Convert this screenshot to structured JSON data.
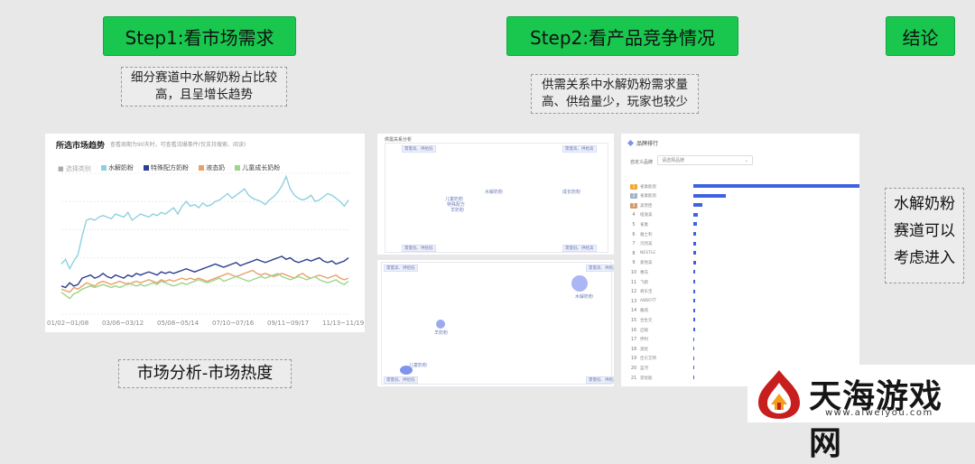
{
  "step1": {
    "title": "Step1:看市场需求",
    "note_line1": "细分赛道中水解奶粉占比较",
    "note_line2": "高，且呈增长趋势"
  },
  "step2": {
    "title": "Step2:看产品竞争情况",
    "note_line1": "供需关系中水解奶粉需求量",
    "note_line2": "高、供给量少，玩家也较少"
  },
  "conclusion": {
    "title": "结论",
    "text_line1": "水解奶粉",
    "text_line2": "赛道可以",
    "text_line3": "考虑进入"
  },
  "bottom_label": "市场分析-市场热度",
  "trend_panel": {
    "title": "所选市场趋势",
    "subtitle": "查看周期为90天时，可查看流爆事件(仅支持搜索、阅读)"
  },
  "rank_panel": {
    "title": "品牌排行",
    "filter_label": "自定义品牌",
    "filter_value": "请选择品牌",
    "items": [
      {
        "rank": "1",
        "name": "雀巢能恩",
        "value": 100
      },
      {
        "rank": "2",
        "name": "雀巢能恩",
        "value": 19
      },
      {
        "rank": "3",
        "name": "美赞臣",
        "value": 5
      },
      {
        "rank": "4",
        "name": "纽滋美",
        "value": 2.6
      },
      {
        "rank": "5",
        "name": "雀巢",
        "value": 2
      },
      {
        "rank": "6",
        "name": "雅士利",
        "value": 1.8
      },
      {
        "rank": "7",
        "name": "贝因美",
        "value": 1.6
      },
      {
        "rank": "8",
        "name": "NESTLE",
        "value": 1.5
      },
      {
        "rank": "9",
        "name": "爱他美",
        "value": 1.4
      },
      {
        "rank": "10",
        "name": "惠氏",
        "value": 1.3
      },
      {
        "rank": "11",
        "name": "飞鹤",
        "value": 1.2
      },
      {
        "rank": "12",
        "name": "君乐宝",
        "value": 1.1
      },
      {
        "rank": "13",
        "name": "ABBOTT",
        "value": 1
      },
      {
        "rank": "14",
        "name": "雅培",
        "value": 0.9
      },
      {
        "rank": "15",
        "name": "合生元",
        "value": 0.8
      },
      {
        "rank": "16",
        "name": "启赋",
        "value": 0.8
      },
      {
        "rank": "17",
        "name": "伊利",
        "value": 0.7
      },
      {
        "rank": "18",
        "name": "澳优",
        "value": 0.7
      },
      {
        "rank": "19",
        "name": "佳贝艾特",
        "value": 0.6
      },
      {
        "rank": "20",
        "name": "蓝河",
        "value": 0.6
      },
      {
        "rank": "21",
        "name": "诺优能",
        "value": 0.5
      }
    ]
  },
  "supply_panel": {
    "title": "供需关系分析",
    "tags": [
      "需量高、供给低",
      "需量高、供给高",
      "需量低、供给低",
      "需量低、供给高"
    ],
    "labels": [
      "儿童奶粉",
      "特殊配方",
      "水解奶粉",
      "成长奶粉",
      "羊奶粉"
    ],
    "tags2": [
      "需量高、供给低",
      "需量高、供给高",
      "需量低、供给低",
      "需量低、供给高"
    ],
    "bubble_labels": [
      "水解奶粉",
      "羊奶粉",
      "儿童奶粉"
    ]
  },
  "logo": {
    "main": "天海游戏网",
    "url": "www.aiweiyou.com"
  },
  "chart_data": {
    "type": "line",
    "legend_prefix": "■ 选择类别",
    "x_ticks": [
      "01/02~01/08",
      "03/06~03/12",
      "05/08~05/14",
      "07/10~07/16",
      "09/11~09/17",
      "11/13~11/19"
    ],
    "series": [
      {
        "name": "水解奶粉",
        "color": "#8fd0e0",
        "values": [
          42,
          45,
          39,
          44,
          48,
          60,
          70,
          71,
          70,
          72,
          73,
          72,
          71,
          74,
          73,
          72,
          75,
          70,
          72,
          74,
          73,
          72,
          74,
          73,
          75,
          74,
          76,
          78,
          74,
          79,
          82,
          79,
          80,
          78,
          81,
          79,
          80,
          82,
          83,
          85,
          87,
          84,
          86,
          88,
          90,
          86,
          84,
          83,
          82,
          80,
          83,
          85,
          88,
          92,
          98,
          90,
          86,
          84,
          83,
          84,
          86,
          82,
          83,
          85,
          87,
          86,
          84,
          82,
          79,
          83
        ]
      },
      {
        "name": "特殊配方奶粉",
        "color": "#2d3f8f",
        "values": [
          28,
          27,
          30,
          28,
          29,
          33,
          34,
          35,
          33,
          34,
          36,
          34,
          33,
          35,
          34,
          33,
          35,
          34,
          36,
          35,
          36,
          37,
          36,
          35,
          37,
          36,
          37,
          36,
          37,
          38,
          39,
          38,
          37,
          38,
          39,
          40,
          41,
          42,
          41,
          40,
          41,
          42,
          43,
          41,
          42,
          43,
          44,
          45,
          44,
          43,
          44,
          45,
          46,
          47,
          45,
          46,
          44,
          43,
          44,
          45,
          44,
          45,
          46,
          44,
          43,
          44,
          42,
          43,
          44,
          46
        ]
      },
      {
        "name": "液态奶",
        "color": "#e9a06a",
        "values": [
          26,
          25,
          24,
          27,
          26,
          28,
          30,
          29,
          28,
          30,
          31,
          30,
          29,
          30,
          31,
          30,
          29,
          30,
          31,
          30,
          31,
          32,
          31,
          30,
          32,
          31,
          32,
          31,
          32,
          33,
          32,
          33,
          32,
          33,
          32,
          31,
          32,
          33,
          34,
          35,
          36,
          35,
          34,
          35,
          36,
          37,
          38,
          36,
          35,
          36,
          35,
          34,
          35,
          36,
          35,
          34,
          33,
          35,
          36,
          34,
          33,
          34,
          35,
          34,
          33,
          34,
          35,
          33,
          32,
          33
        ]
      },
      {
        "name": "儿童成长奶粉",
        "color": "#9dd58a",
        "values": [
          24,
          22,
          20,
          23,
          24,
          26,
          27,
          28,
          27,
          28,
          29,
          28,
          27,
          28,
          27,
          28,
          30,
          29,
          28,
          29,
          28,
          29,
          30,
          29,
          31,
          30,
          29,
          28,
          29,
          30,
          29,
          30,
          31,
          32,
          31,
          30,
          31,
          32,
          33,
          31,
          32,
          33,
          34,
          33,
          32,
          31,
          32,
          33,
          34,
          33,
          34,
          35,
          36,
          34,
          33,
          32,
          33,
          34,
          33,
          32,
          33,
          34,
          32,
          31,
          30,
          31,
          32,
          30,
          29,
          31
        ]
      }
    ]
  }
}
